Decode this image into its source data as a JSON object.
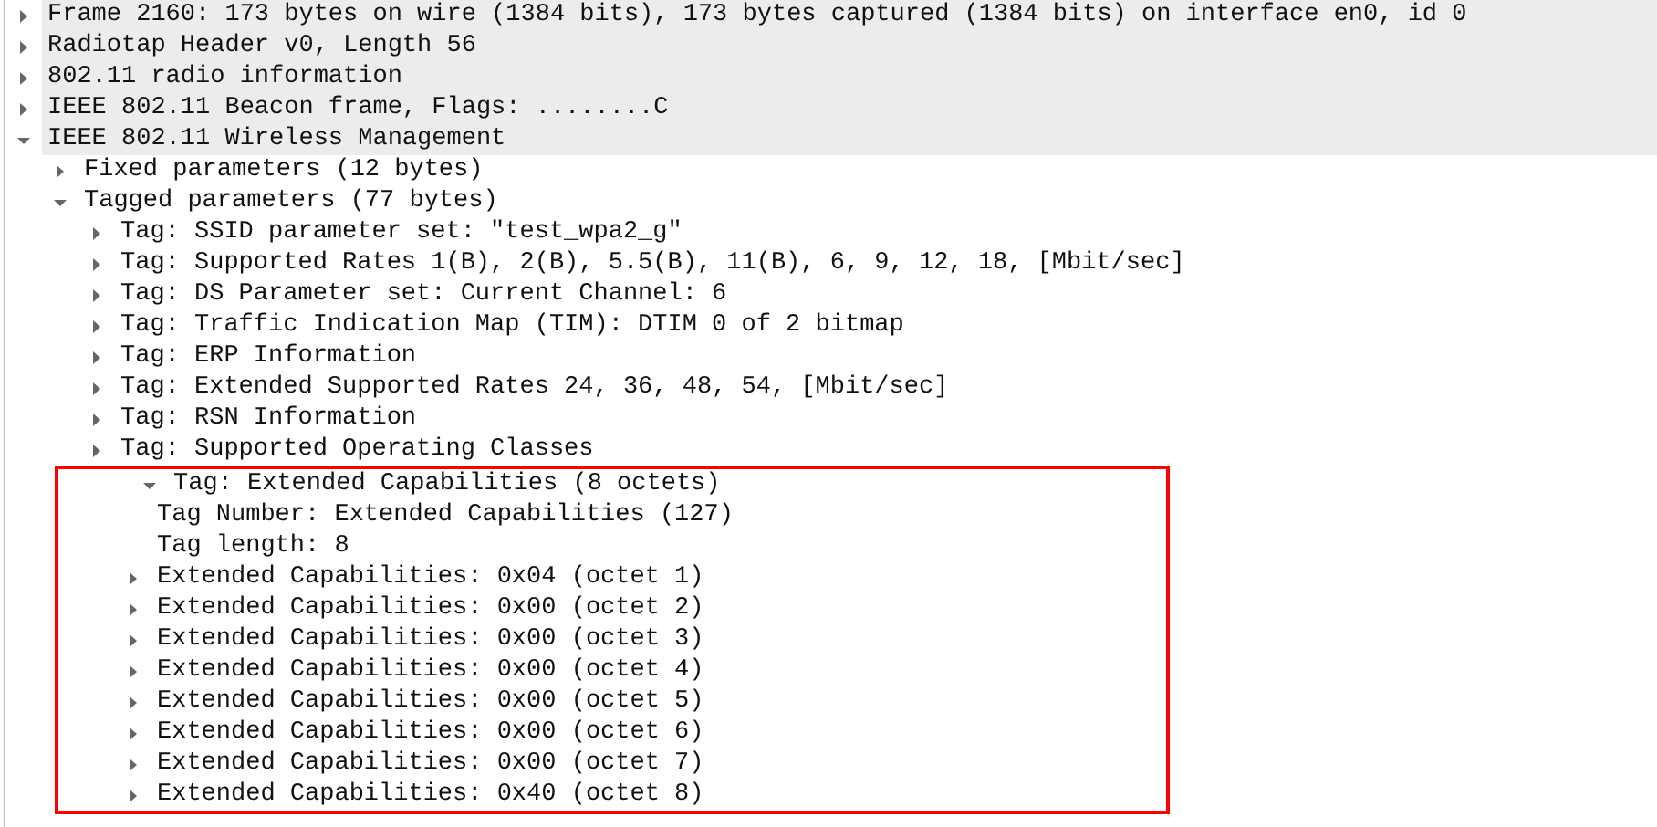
{
  "tree": [
    {
      "kind": "branch",
      "text": "Frame 2160: 173 bytes on wire (1384 bits), 173 bytes captured (1384 bits) on interface en0, id 0",
      "expanded": false
    },
    {
      "kind": "branch",
      "text": "Radiotap Header v0, Length 56",
      "expanded": false
    },
    {
      "kind": "branch",
      "text": "802.11 radio information",
      "expanded": false
    },
    {
      "kind": "branch",
      "text": "IEEE 802.11 Beacon frame, Flags: ........C",
      "expanded": false
    },
    {
      "kind": "branch",
      "text": "IEEE 802.11 Wireless Management",
      "expanded": true,
      "children": [
        {
          "kind": "branch",
          "text": "Fixed parameters (12 bytes)",
          "expanded": false
        },
        {
          "kind": "branch",
          "text": "Tagged parameters (77 bytes)",
          "expanded": true,
          "children": [
            {
              "kind": "branch",
              "text": "Tag: SSID parameter set: \"test_wpa2_g\"",
              "expanded": false
            },
            {
              "kind": "branch",
              "text": "Tag: Supported Rates 1(B), 2(B), 5.5(B), 11(B), 6, 9, 12, 18, [Mbit/sec]",
              "expanded": false
            },
            {
              "kind": "branch",
              "text": "Tag: DS Parameter set: Current Channel: 6",
              "expanded": false
            },
            {
              "kind": "branch",
              "text": "Tag: Traffic Indication Map (TIM): DTIM 0 of 2 bitmap",
              "expanded": false
            },
            {
              "kind": "branch",
              "text": "Tag: ERP Information",
              "expanded": false
            },
            {
              "kind": "branch",
              "text": "Tag: Extended Supported Rates 24, 36, 48, 54, [Mbit/sec]",
              "expanded": false
            },
            {
              "kind": "branch",
              "text": "Tag: RSN Information",
              "expanded": false
            },
            {
              "kind": "branch",
              "text": "Tag: Supported Operating Classes",
              "expanded": false
            },
            {
              "kind": "branch",
              "text": "Tag: Extended Capabilities (8 octets)",
              "expanded": true,
              "highlighted": true,
              "children": [
                {
                  "kind": "leaf",
                  "text": "Tag Number: Extended Capabilities (127)"
                },
                {
                  "kind": "leaf",
                  "text": "Tag length: 8"
                },
                {
                  "kind": "branch",
                  "text": "Extended Capabilities: 0x04 (octet 1)",
                  "expanded": false
                },
                {
                  "kind": "branch",
                  "text": "Extended Capabilities: 0x00 (octet 2)",
                  "expanded": false
                },
                {
                  "kind": "branch",
                  "text": "Extended Capabilities: 0x00 (octet 3)",
                  "expanded": false
                },
                {
                  "kind": "branch",
                  "text": "Extended Capabilities: 0x00 (octet 4)",
                  "expanded": false
                },
                {
                  "kind": "branch",
                  "text": "Extended Capabilities: 0x00 (octet 5)",
                  "expanded": false
                },
                {
                  "kind": "branch",
                  "text": "Extended Capabilities: 0x00 (octet 6)",
                  "expanded": false
                },
                {
                  "kind": "branch",
                  "text": "Extended Capabilities: 0x00 (octet 7)",
                  "expanded": false
                },
                {
                  "kind": "branch",
                  "text": "Extended Capabilities: 0x40 (octet 8)",
                  "expanded": false
                }
              ]
            }
          ]
        }
      ]
    }
  ]
}
